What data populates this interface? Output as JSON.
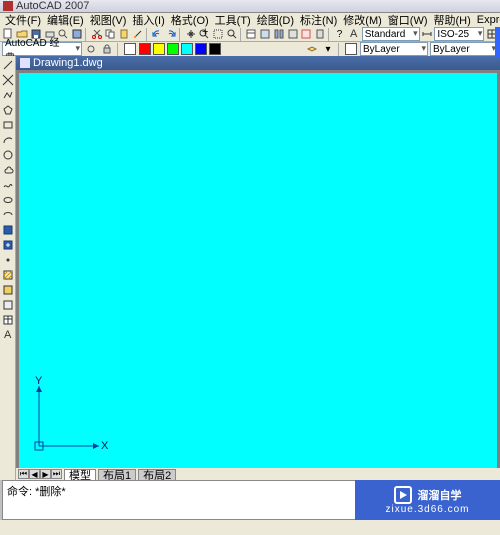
{
  "title": "AutoCAD 2007",
  "menu": {
    "file": "文件(F)",
    "edit": "编辑(E)",
    "view": "视图(V)",
    "insert": "插入(I)",
    "format": "格式(O)",
    "tools": "工具(T)",
    "draw": "绘图(D)",
    "dim": "标注(N)",
    "modify": "修改(M)",
    "window": "窗口(W)",
    "help": "帮助(H)",
    "express": "Express"
  },
  "style_sel": "Standard",
  "dimstyle_sel": "ISO-25",
  "workspace_sel": "AutoCAD 经典",
  "layer": {
    "line": "ByLayer",
    "color": "ByLayer"
  },
  "drawing_title": "Drawing1.dwg",
  "axes": {
    "x": "X",
    "y": "Y"
  },
  "tabs": {
    "model": "模型",
    "layout1": "布局1",
    "layout2": "布局2"
  },
  "command": {
    "line1": "命令: *删除*",
    "line2": ""
  },
  "watermark": {
    "brand": "溜溜自学",
    "url": "zixue.3d66.com"
  }
}
